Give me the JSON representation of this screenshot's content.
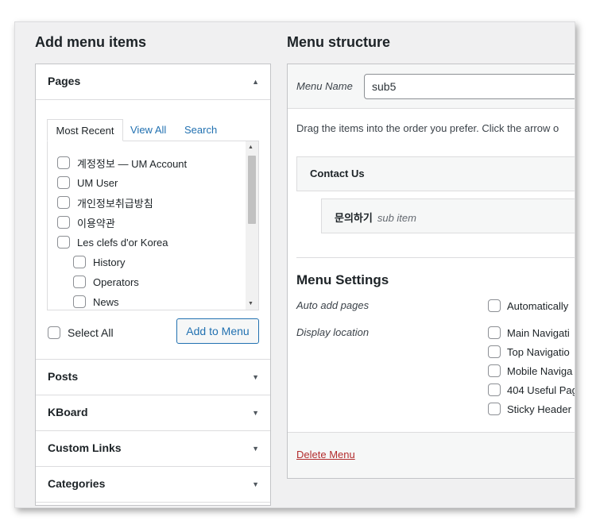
{
  "left": {
    "title": "Add menu items",
    "pages": {
      "header": "Pages",
      "tabs": [
        "Most Recent",
        "View All",
        "Search"
      ],
      "items": [
        {
          "label": "계정정보 — UM Account"
        },
        {
          "label": "UM User"
        },
        {
          "label": "개인정보취급방침"
        },
        {
          "label": "이용약관"
        },
        {
          "label": "Les clefs d'or Korea"
        },
        {
          "label": "History"
        },
        {
          "label": "Operators"
        },
        {
          "label": "News"
        }
      ],
      "select_all": "Select All",
      "add_button": "Add to Menu"
    },
    "sections": [
      {
        "label": "Posts"
      },
      {
        "label": "KBoard"
      },
      {
        "label": "Custom Links"
      },
      {
        "label": "Categories"
      }
    ]
  },
  "right": {
    "title": "Menu structure",
    "menu_name_label": "Menu Name",
    "menu_name_value": "sub5",
    "drag_text": "Drag the items into the order you prefer. Click the arrow o",
    "menu_items": [
      {
        "title": "Contact Us",
        "sub": ""
      },
      {
        "title": "문의하기",
        "sub": "sub item"
      }
    ],
    "settings": {
      "title": "Menu Settings",
      "auto_add_label": "Auto add pages",
      "auto_add_option": "Automatically",
      "display_location_label": "Display location",
      "locations": [
        "Main Navigati",
        "Top Navigatio",
        "Mobile Naviga",
        "404 Useful Pag",
        "Sticky Header"
      ]
    },
    "delete_link": "Delete Menu"
  },
  "colors": {
    "link": "#2271b1",
    "delete": "#b32d2e",
    "panel_bg": "#f0f0f1"
  }
}
